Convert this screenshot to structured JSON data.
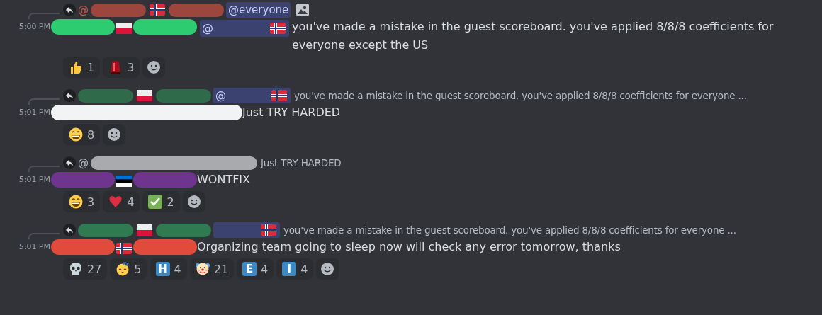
{
  "messages": [
    {
      "reply": {
        "parts": [
          {
            "kind": "text",
            "text": "@",
            "color": "#c4574c"
          },
          {
            "kind": "redaction",
            "color": "#9c463d"
          },
          {
            "kind": "norway"
          },
          {
            "kind": "redaction",
            "color": "#9c463d"
          },
          {
            "kind": "mention",
            "text": "@everyone"
          },
          {
            "kind": "image"
          }
        ]
      },
      "time": "5:00 PM",
      "author": [
        {
          "kind": "redaction",
          "color": "#2ecc71"
        },
        {
          "kind": "poland"
        },
        {
          "kind": "redaction",
          "color": "#2ecc71"
        }
      ],
      "mention": {
        "text": "@",
        "flag": {
          "kind": "norway"
        }
      },
      "text": "you've made a mistake in the guest scoreboard. you've applied 8/8/8 coefficients for everyone except the US",
      "reactions": [
        {
          "kind": "thumbs_up",
          "count": "1"
        },
        {
          "kind": "siren",
          "count": "3"
        }
      ]
    },
    {
      "reply": {
        "parts": [
          {
            "kind": "redaction",
            "color": "#2f6a4b"
          },
          {
            "kind": "poland"
          },
          {
            "kind": "redaction",
            "color": "#2f6a4b"
          },
          {
            "kind": "mention",
            "text": "@",
            "flag": {
              "kind": "norway"
            }
          }
        ],
        "text": "you've made a mistake in the guest scoreboard. you've applied 8/8/8 coefficients for everyone ..."
      },
      "time": "5:01 PM",
      "author": [
        {
          "kind": "redaction",
          "color": "#f2f3f5"
        }
      ],
      "text": "Just TRY HARDED",
      "reactions": [
        {
          "kind": "grin",
          "count": "8"
        }
      ]
    },
    {
      "reply": {
        "parts": [
          {
            "kind": "text",
            "text": "@",
            "color": "#b5bac1"
          },
          {
            "kind": "redaction",
            "color": "#a9aaae"
          }
        ],
        "text": "Just TRY HARDED"
      },
      "time": "5:01 PM",
      "author": [
        {
          "kind": "redaction",
          "color": "#6f358e"
        },
        {
          "kind": "estonia"
        },
        {
          "kind": "redaction",
          "color": "#6f358e"
        }
      ],
      "text": "WONTFIX",
      "reactions": [
        {
          "kind": "grin",
          "count": "3"
        },
        {
          "kind": "heart",
          "count": "4"
        },
        {
          "kind": "check",
          "count": "2"
        }
      ]
    },
    {
      "reply": {
        "parts": [
          {
            "kind": "redaction",
            "color": "#2f7a50"
          },
          {
            "kind": "poland"
          },
          {
            "kind": "redaction",
            "color": "#2f7a50"
          },
          {
            "kind": "mention",
            "flag": {
              "kind": "norway"
            }
          }
        ],
        "text": "you've made a mistake in the guest scoreboard. you've applied 8/8/8 coefficients for everyone ..."
      },
      "time": "5:01 PM",
      "author": [
        {
          "kind": "redaction",
          "color": "#e04b3b"
        },
        {
          "kind": "norway"
        },
        {
          "kind": "redaction",
          "color": "#e04b3b"
        }
      ],
      "text": "Organizing team going to sleep now will check any error tomorrow, thanks",
      "reactions": [
        {
          "kind": "skull",
          "count": "27"
        },
        {
          "kind": "sleeping",
          "count": "5"
        },
        {
          "kind": "letter",
          "text": "H",
          "count": "4"
        },
        {
          "kind": "clown",
          "count": "21"
        },
        {
          "kind": "letter",
          "text": "E",
          "count": "4"
        },
        {
          "kind": "letter",
          "text": "I",
          "count": "4"
        }
      ]
    }
  ]
}
